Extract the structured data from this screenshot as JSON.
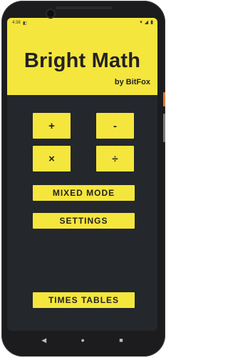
{
  "status": {
    "time": "4:38",
    "left_icon": "◧",
    "right_icons": [
      "wifi-icon",
      "signal-icon",
      "battery-icon"
    ]
  },
  "app": {
    "title": "Bright Math",
    "subtitle": "by BitFox"
  },
  "ops": {
    "add": "+",
    "subtract": "-",
    "multiply": "×",
    "divide": "÷"
  },
  "buttons": {
    "mixed": "MIXED MODE",
    "settings": "SETTINGS",
    "times_tables": "TIMES TABLES"
  },
  "nav": {
    "back": "◀",
    "home": "●",
    "recents": "■"
  },
  "colors": {
    "accent": "#f5e63d",
    "background": "#24272b",
    "text": "#222222"
  }
}
